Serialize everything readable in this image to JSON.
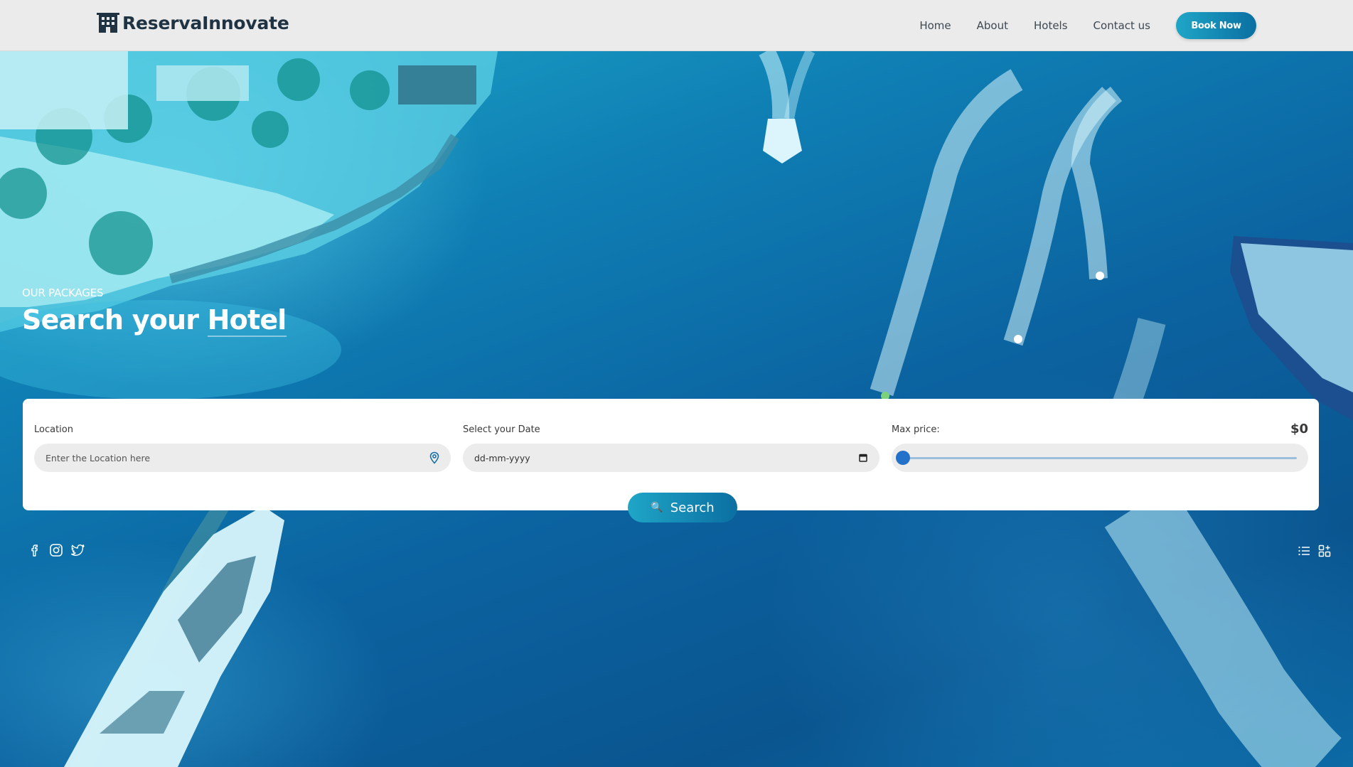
{
  "brand": {
    "name": "ReservaInnovate",
    "icon": "building-icon"
  },
  "nav": {
    "links": [
      "Home",
      "About",
      "Hotels",
      "Contact us"
    ],
    "cta": "Book Now"
  },
  "hero": {
    "eyebrow": "OUR PACKAGES",
    "title_part1": "Search your",
    "title_part2": "Hotel",
    "background": "aerial-ocean-resort-photo"
  },
  "search": {
    "location": {
      "label": "Location",
      "placeholder": "Enter the Location here",
      "icon": "map-pin-icon"
    },
    "date": {
      "label": "Select your Date",
      "value": "dd-mm-yyyy",
      "icon": "calendar-icon"
    },
    "price": {
      "label": "Max price:",
      "value": "$0",
      "slider_fraction": 0
    },
    "button": "Search",
    "button_icon": "search-icon"
  },
  "social": [
    "facebook-icon",
    "instagram-icon",
    "twitter-icon"
  ],
  "views": [
    "list-view-icon",
    "grid-view-icon"
  ],
  "colors": {
    "accent_start": "#1fa6c7",
    "accent_end": "#0b6fa2",
    "slider": "#2371c8",
    "header_bg": "#ebebeb"
  }
}
